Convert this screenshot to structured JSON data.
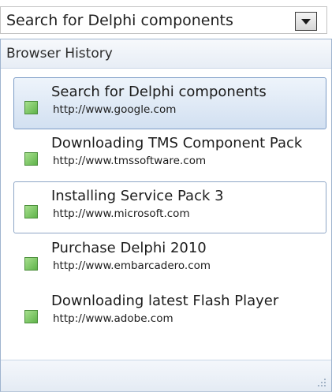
{
  "combo": {
    "value": "Search for Delphi components",
    "button_icon": "chevron-down-icon"
  },
  "panel": {
    "header": "Browser History",
    "items": [
      {
        "title": "Search for Delphi components",
        "url": "http://www.google.com",
        "state": "selected"
      },
      {
        "title": "Downloading TMS Component Pack",
        "url": "http://www.tmssoftware.com",
        "state": "normal"
      },
      {
        "title": "Installing Service Pack 3",
        "url": "http://www.microsoft.com",
        "state": "focused"
      },
      {
        "title": "Purchase Delphi 2010",
        "url": "http://www.embarcadero.com",
        "state": "normal"
      },
      {
        "title": "Downloading latest Flash Player",
        "url": "http://www.adobe.com",
        "state": "normal"
      }
    ],
    "footer_icon": "resize-grip-icon"
  },
  "colors": {
    "selected_border": "#7c9cc6",
    "selected_fill": "#d2e0f1",
    "bullet": "#5fb34a"
  }
}
